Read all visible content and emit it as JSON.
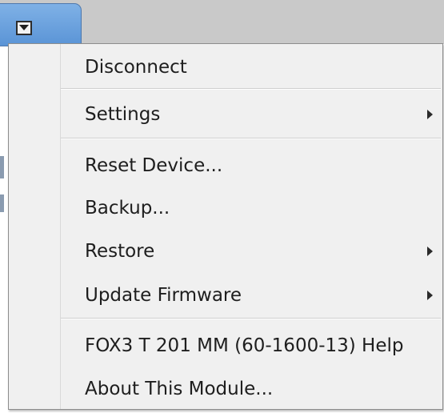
{
  "tab": {
    "button_icon": "dropdown-arrow-icon"
  },
  "menu": {
    "items": [
      {
        "label": "Disconnect",
        "submenu": false
      },
      {
        "label": "Settings",
        "submenu": true
      },
      {
        "label": "Reset Device...",
        "submenu": false
      },
      {
        "label": "Backup...",
        "submenu": false
      },
      {
        "label": "Restore",
        "submenu": true
      },
      {
        "label": "Update Firmware",
        "submenu": true
      },
      {
        "label": "FOX3 T 201 MM (60-1600-13) Help",
        "submenu": false
      },
      {
        "label": "About This Module...",
        "submenu": false
      }
    ]
  },
  "colors": {
    "tab_blue": "#6aa3e0",
    "menu_background": "#f0f0f0",
    "text": "#1e1e1e"
  }
}
